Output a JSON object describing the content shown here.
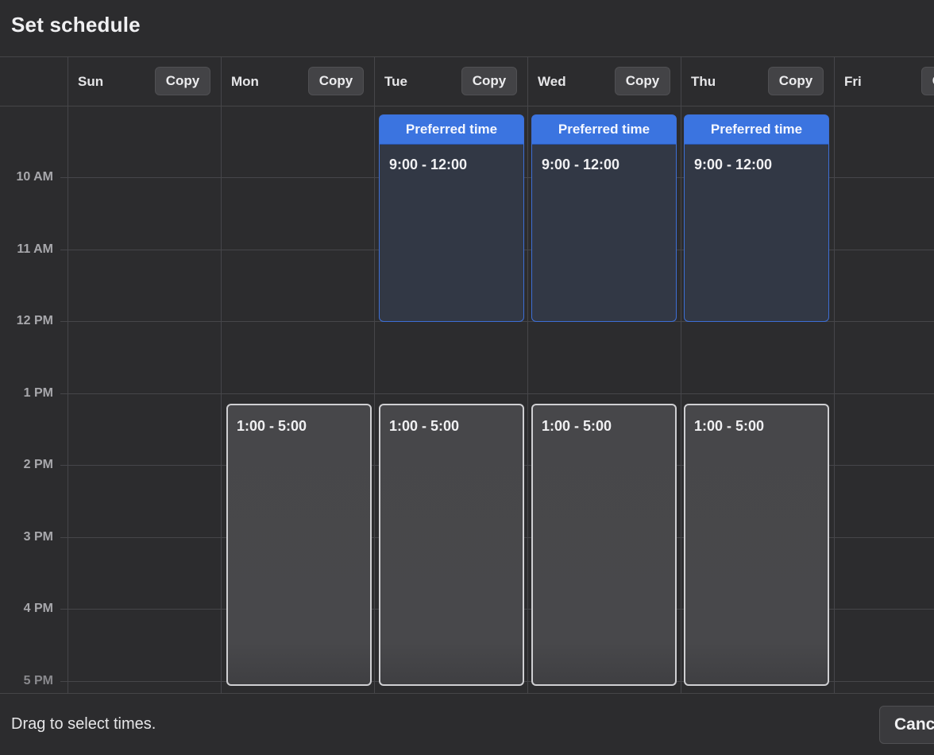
{
  "title": "Set schedule",
  "days": [
    {
      "name": "Sun",
      "copy_label": "Copy"
    },
    {
      "name": "Mon",
      "copy_label": "Copy"
    },
    {
      "name": "Tue",
      "copy_label": "Copy"
    },
    {
      "name": "Wed",
      "copy_label": "Copy"
    },
    {
      "name": "Thu",
      "copy_label": "Copy"
    },
    {
      "name": "Fri",
      "copy_label": "Copy"
    }
  ],
  "hours": [
    "10 AM",
    "11 AM",
    "12 PM",
    "1 PM",
    "2 PM",
    "3 PM",
    "4 PM",
    "5 PM"
  ],
  "blocks": {
    "preferred": [
      {
        "day": "Tue",
        "header": "Preferred time",
        "range": "9:00 - 12:00"
      },
      {
        "day": "Wed",
        "header": "Preferred time",
        "range": "9:00 - 12:00"
      },
      {
        "day": "Thu",
        "header": "Preferred time",
        "range": "9:00 - 12:00"
      }
    ],
    "available": [
      {
        "day": "Mon",
        "range": "1:00 - 5:00"
      },
      {
        "day": "Tue",
        "range": "1:00 - 5:00"
      },
      {
        "day": "Wed",
        "range": "1:00 - 5:00"
      },
      {
        "day": "Thu",
        "range": "1:00 - 5:00"
      }
    ]
  },
  "footer": {
    "hint": "Drag to select times.",
    "cancel_label": "Cancel"
  },
  "colors": {
    "accent": "#3b74e0",
    "background": "#2c2c2e"
  }
}
